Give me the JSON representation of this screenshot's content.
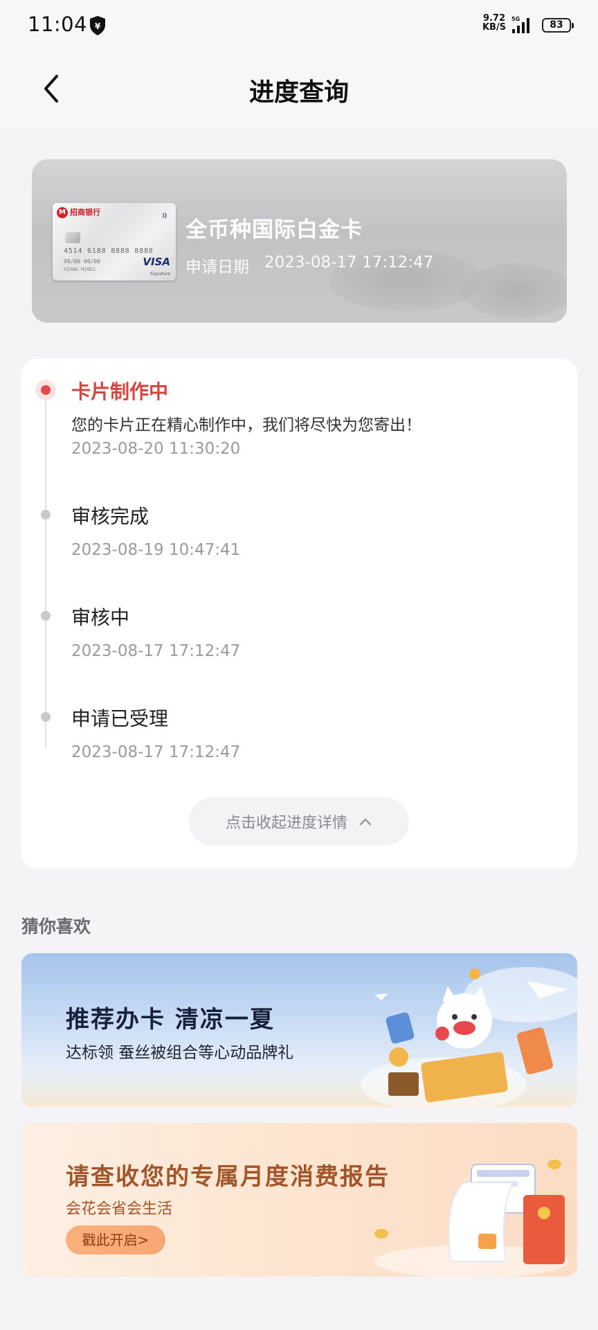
{
  "status_bar": {
    "time": "11:04",
    "net_speed_value": "9.72",
    "net_speed_unit": "KB/S",
    "network_type": "5G",
    "battery": "83"
  },
  "nav": {
    "title": "进度查询"
  },
  "card": {
    "bank_name": "招商银行",
    "number": "4514 6188 8888 8888",
    "expiry": "00/00 00/00",
    "holder": "XIANG MINGI",
    "network": "VISA",
    "network_sub": "Signature",
    "name": "全币种国际白金卡",
    "apply_label": "申请日期",
    "apply_date": "2023-08-17 17:12:47"
  },
  "progress": {
    "steps": [
      {
        "title": "卡片制作中",
        "desc": "您的卡片正在精心制作中，我们将尽快为您寄出！",
        "time": "2023-08-20 11:30:20",
        "active": true
      },
      {
        "title": "审核完成",
        "time": "2023-08-19 10:47:41",
        "active": false
      },
      {
        "title": "审核中",
        "time": "2023-08-17 17:12:47",
        "active": false
      },
      {
        "title": "申请已受理",
        "time": "2023-08-17 17:12:47",
        "active": false
      }
    ],
    "collapse_label": "点击收起进度详情"
  },
  "recommend": {
    "section_title": "猜你喜欢",
    "banners": [
      {
        "headline": "推荐办卡 清凉一夏",
        "sub": "达标领 蚕丝被组合等心动品牌礼"
      },
      {
        "headline": "请查收您的专属月度消费报告",
        "sub": "会花会省会生活",
        "cta": "戳此开启>"
      }
    ]
  },
  "colors": {
    "accent_red": "#e8484d",
    "active_title": "#d8433f",
    "muted_text": "#9a9a9e",
    "report_brown": "#a2552a"
  },
  "icons": [
    "shield-icon",
    "signal-icon",
    "battery-icon",
    "back-icon",
    "contactless-icon",
    "chevron-up-icon"
  ]
}
